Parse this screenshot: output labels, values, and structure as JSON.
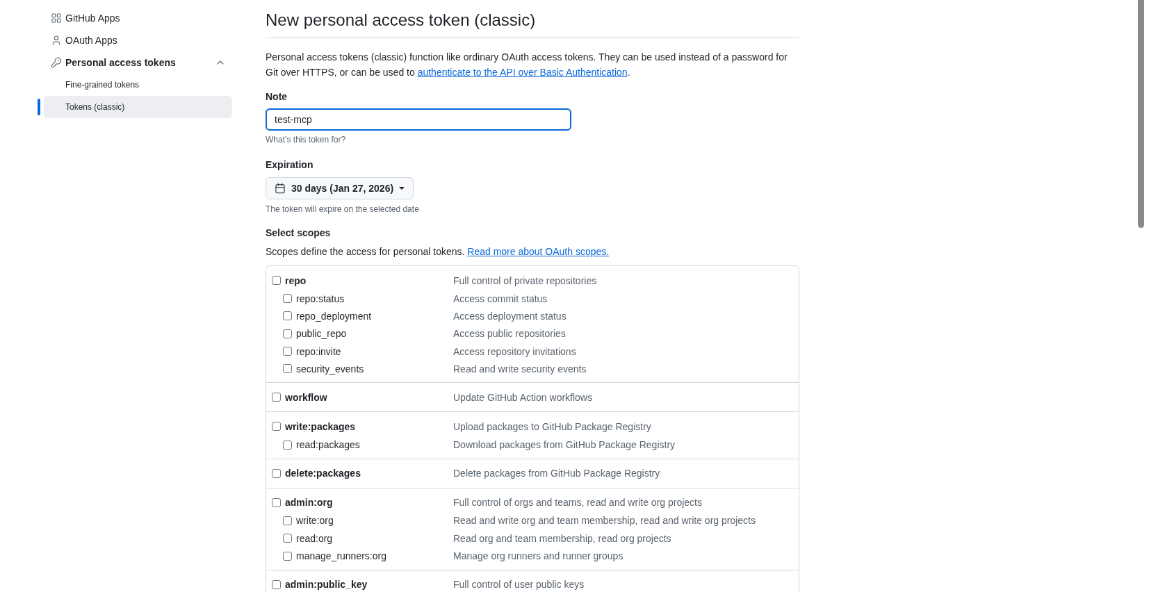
{
  "sidebar": {
    "items": [
      {
        "label": "GitHub Apps",
        "selected": false
      },
      {
        "label": "OAuth Apps",
        "selected": false
      },
      {
        "label": "Personal access tokens",
        "selected": false,
        "expanded": true,
        "children": [
          {
            "label": "Fine-grained tokens",
            "selected": false
          },
          {
            "label": "Tokens (classic)",
            "selected": true
          }
        ]
      }
    ]
  },
  "page": {
    "title": "New personal access token (classic)",
    "intro": {
      "text": "Personal access tokens (classic) function like ordinary OAuth access tokens. They can be used instead of a password for Git over HTTPS, or can be used to ",
      "link": "authenticate to the API over Basic Authentication",
      "text_after": "."
    }
  },
  "note": {
    "label": "Note",
    "value": "test-mcp",
    "focused": true,
    "hint": "What’s this token for?"
  },
  "expiration": {
    "label": "Expiration",
    "value": "30 days (Jan 27, 2026)",
    "hint": "The token will expire on the selected date"
  },
  "scopes": {
    "label": "Select scopes",
    "description": "Scopes define the access for personal tokens. ",
    "link": "Read more about OAuth scopes.",
    "groups": [
      {
        "name": "repo",
        "description": "Full control of private repositories",
        "checked": false,
        "children": [
          {
            "name": "repo:status",
            "description": "Access commit status",
            "checked": false
          },
          {
            "name": "repo_deployment",
            "description": "Access deployment status",
            "checked": false
          },
          {
            "name": "public_repo",
            "description": "Access public repositories",
            "checked": false
          },
          {
            "name": "repo:invite",
            "description": "Access repository invitations",
            "checked": false
          },
          {
            "name": "security_events",
            "description": "Read and write security events",
            "checked": false
          }
        ]
      },
      {
        "name": "workflow",
        "description": "Update GitHub Action workflows",
        "checked": false
      },
      {
        "name": "write:packages",
        "description": "Upload packages to GitHub Package Registry",
        "checked": false,
        "children": [
          {
            "name": "read:packages",
            "description": "Download packages from GitHub Package Registry",
            "checked": false
          }
        ]
      },
      {
        "name": "delete:packages",
        "description": "Delete packages from GitHub Package Registry",
        "checked": false
      },
      {
        "name": "admin:org",
        "description": "Full control of orgs and teams, read and write org projects",
        "checked": false,
        "children": [
          {
            "name": "write:org",
            "description": "Read and write org and team membership, read and write org projects",
            "checked": false
          },
          {
            "name": "read:org",
            "description": "Read org and team membership, read org projects",
            "checked": false
          },
          {
            "name": "manage_runners:org",
            "description": "Manage org runners and runner groups",
            "checked": false
          }
        ]
      },
      {
        "name": "admin:public_key",
        "description": "Full control of user public keys",
        "checked": false
      }
    ]
  }
}
